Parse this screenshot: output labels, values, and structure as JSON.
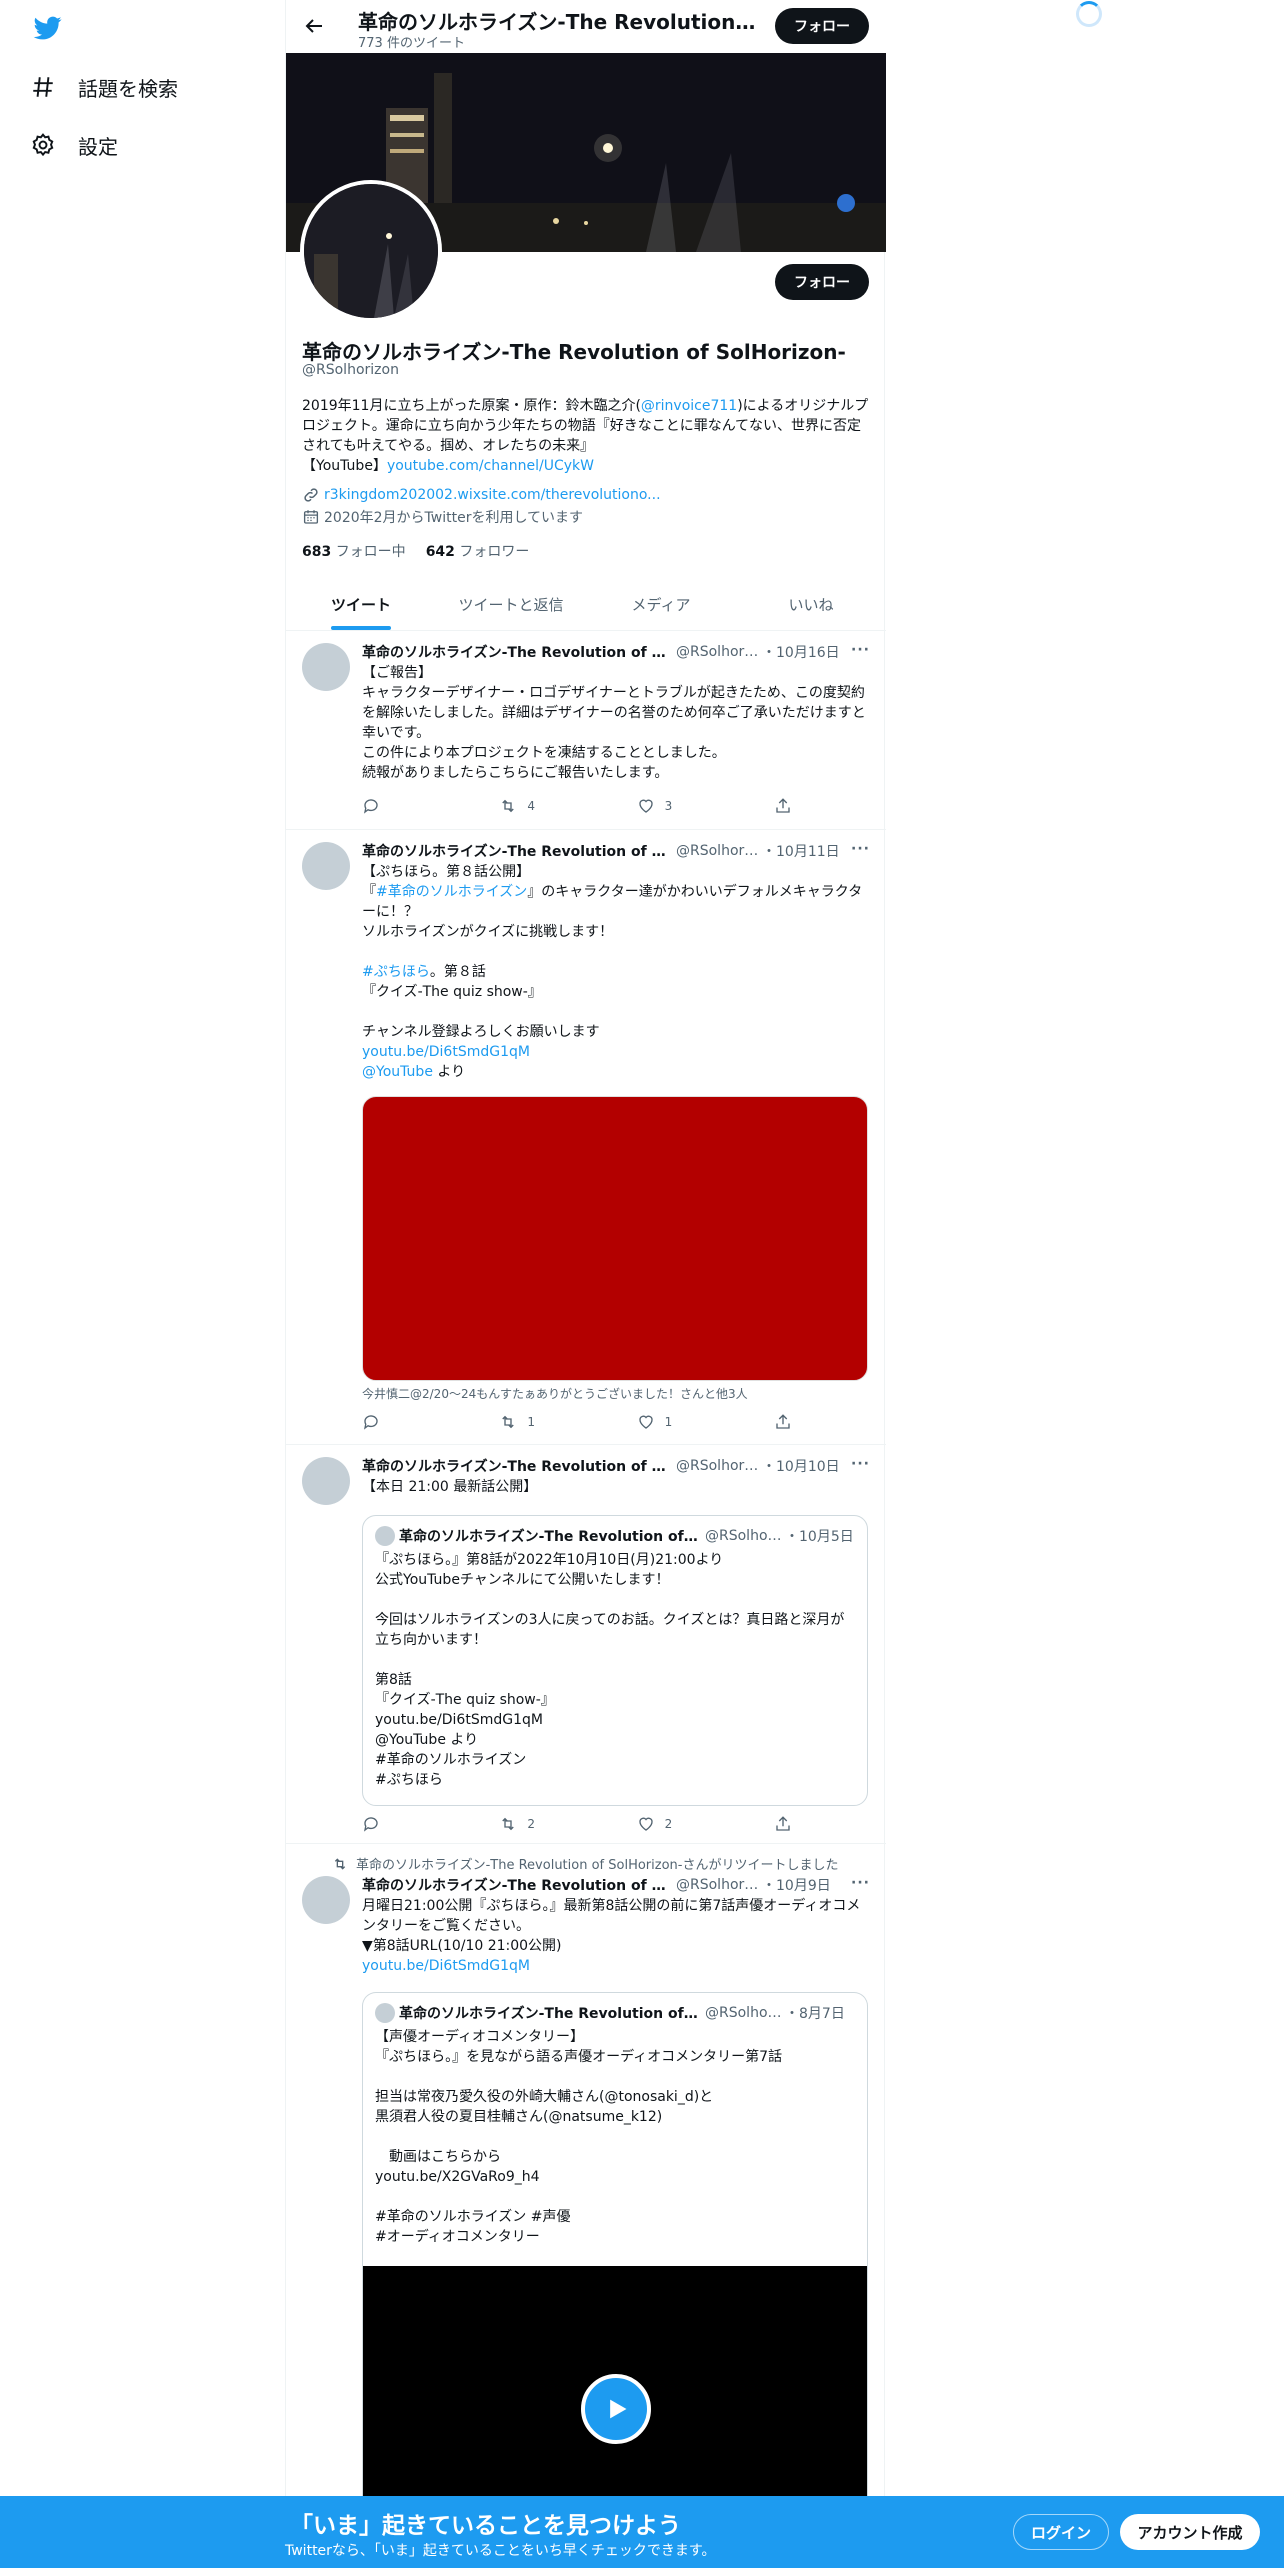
{
  "nav": {
    "logo_icon": "twitter-bird-icon",
    "explore_label": "話題を検索",
    "settings_label": "設定"
  },
  "header": {
    "name": "革命のソルホライズン-The Revolution of SolHorizon-",
    "tweet_count": "773 件のツイート",
    "follow_label": "フォロー"
  },
  "profile": {
    "name": "革命のソルホライズン-The Revolution of SolHorizon-",
    "handle": "@RSolhorizon",
    "follow_label": "フォロー",
    "bio_1": "2019年11月に立ち上がった原案・原作：鈴木臨之介(",
    "bio_mention": "@rinvoice711",
    "bio_2": ")によるオリジナルプロジェクト。運命に立ち向かう少年たちの物語『好きなことに罪なんてない、世界に否定されても叶えてやる。掴め、オレたちの未来』",
    "bio_3": "【YouTube】",
    "bio_link": "youtube.com/channel/UCykW",
    "website": "r3kingdom202002.wixsite.com/therevolutiono...",
    "joined": "2020年2月からTwitterを利用しています",
    "following_count": "683",
    "following_label": "フォロー中",
    "followers_count": "642",
    "followers_label": "フォロワー"
  },
  "tabs": [
    {
      "label": "ツイート",
      "active": true
    },
    {
      "label": "ツイートと返信"
    },
    {
      "label": "メディア"
    },
    {
      "label": "いいね"
    }
  ],
  "tweets": [
    {
      "name": "革命のソルホライズン-The Revolution of SolHorizon-",
      "handle": "@RSolhorizon",
      "date": "・10月16日",
      "text": "【ご報告】\nキャラクターデザイナー・ロゴデザイナーとトラブルが起きたため、この度契約を解除いたしました。詳細はデザイナーの名誉のため何卒ご了承いただけますと幸いです。\nこの件により本プロジェクトを凍結することとしました。\n続報がありましたらこちらにご報告いたします。",
      "replies": "",
      "retweets": "4",
      "likes": "3"
    },
    {
      "name": "革命のソルホライズン-The Revolution of SolHorizon-",
      "handle": "@RSolhorizon",
      "date": "・10月11日",
      "text_1": "【ぷちほら。第８話公開】\n『",
      "hashtag_1": "#革命のソルホライズン",
      "text_2": "』のキャラクター達がかわいいデフォルメキャラクターに！？\nソルホライズンがクイズに挑戦します！\n\n",
      "hashtag_2": "#ぷちほら",
      "text_3": "。第８話\n『クイズ-The quiz show-』\n\nチャンネル登録よろしくお願いします\n",
      "link": "youtu.be/Di6tSmdG1qM",
      "mention": "@YouTube",
      "text_4": " より",
      "caption": "今井慎二@2/20〜24もんすたぁありがとうございました！さんと他3人",
      "replies": "",
      "retweets": "1",
      "likes": "1"
    },
    {
      "name": "革命のソルホライズン-The Revolution of SolHorizon-",
      "handle": "@RSolhorizon",
      "date": "・10月10日",
      "text": "【本日 21:00 最新話公開】",
      "quote": {
        "name": "革命のソルホライズン-The Revolution of SolHorizon-",
        "handle": "@RSolhorizon",
        "date": "・10月5日",
        "text": "『ぷちほら。』第8話が2022年10月10日(月)21:00より\n公式YouTubeチャンネルにて公開いたします！\n\n今回はソルホライズンの3人に戻ってのお話。クイズとは？真日路と深月が立ち向かいます！\n\n第8話\n『クイズ-The quiz show-』\nyoutu.be/Di6tSmdG1qM\n@YouTube より\n#革命のソルホライズン\n#ぷちほら"
      },
      "replies": "",
      "retweets": "2",
      "likes": "2"
    },
    {
      "retweet_label": "革命のソルホライズン-The Revolution of SolHorizon-さんがリツイートしました",
      "name": "革命のソルホライズン-The Revolution of SolHorizon-",
      "handle": "@RSolhorizon",
      "date": "・10月9日",
      "text": "月曜日21:00公開『ぷちほら。』最新第8話公開の前に第7話声優オーディオコメンタリーをご覧ください。\n▼第8話URL(10/10 21:00公開)\n",
      "link": "youtu.be/Di6tSmdG1qM",
      "quote": {
        "name": "革命のソルホライズン-The Revolution of SolHorizon-",
        "handle": "@RSolhorizon",
        "date": "・8月7日",
        "text": "【声優オーディオコメンタリー】\n『ぷちほら。』を見ながら語る声優オーディオコメンタリー第7話\n\n担当は常夜乃愛久役の外崎大輔さん(@tonosaki_d)と\n黒須君人役の夏目桂輔さん(@natsume_k12)\n\n　動画はこちらから\nyoutu.be/X2GVaRo9_h4\n\n#革命のソルホライズン #声優\n#オーディオコメンタリー"
      }
    }
  ],
  "bottom": {
    "title": "「いま」起きていることを見つけよう",
    "subtitle": "Twitterなら、「いま」起きていることをいち早くチェックできます。",
    "login_label": "ログイン",
    "signup_label": "アカウント作成"
  },
  "colors": {
    "accent": "#1d9bf0",
    "text": "#0f1419",
    "muted": "#536471",
    "media_red": "#b30000"
  }
}
